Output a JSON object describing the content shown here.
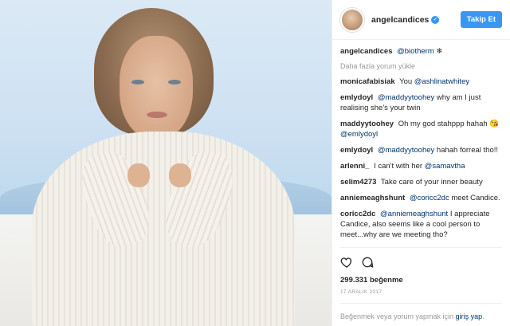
{
  "header": {
    "username": "angelcandices",
    "follow_label": "Takip Et"
  },
  "caption": {
    "user": "angelcandices",
    "mention": "@biotherm",
    "emoji": "❄"
  },
  "load_more": "Daha fazla yorum yükle",
  "comments": [
    {
      "user": "monicafabisiak",
      "pre": "You",
      "mention": "@ashlinatwhitey",
      "post": ""
    },
    {
      "user": "emlydoyl",
      "pre": "",
      "mention": "@maddyytoohey",
      "post": "why am I just realising she's your twin"
    },
    {
      "user": "maddyytoohey",
      "pre": "Oh my god stahppp hahah 😘",
      "mention": "@emlydoyl",
      "post": ""
    },
    {
      "user": "emlydoyl",
      "pre": "",
      "mention": "@maddyytoohey",
      "post": "hahah forreal tho!!"
    },
    {
      "user": "arlenni_",
      "pre": "I can't with her",
      "mention": "@samavtha",
      "post": ""
    },
    {
      "user": "selim4273",
      "pre": "Take care of your inner beauty",
      "mention": "",
      "post": ""
    },
    {
      "user": "anniemeaghshunt",
      "pre": "",
      "mention": "@coricc2dc",
      "post": "meet Candice."
    },
    {
      "user": "coricc2dc",
      "pre": "",
      "mention": "@anniemeaghshunt",
      "post": "I appreciate Candice, also seems like a cool person to meet...why are we meeting tho?"
    }
  ],
  "likes": "299.331 beğenme",
  "date": "17 ARALIK 2017",
  "login": {
    "text": "Beğenmek veya yorum yapmak için",
    "link": "giriş yap",
    "suffix": "."
  },
  "icons": {
    "verified": "verified-badge-icon",
    "heart": "heart-icon",
    "comment": "comment-icon"
  },
  "colors": {
    "accent": "#3897f0",
    "link": "#003569",
    "muted": "#999999"
  }
}
